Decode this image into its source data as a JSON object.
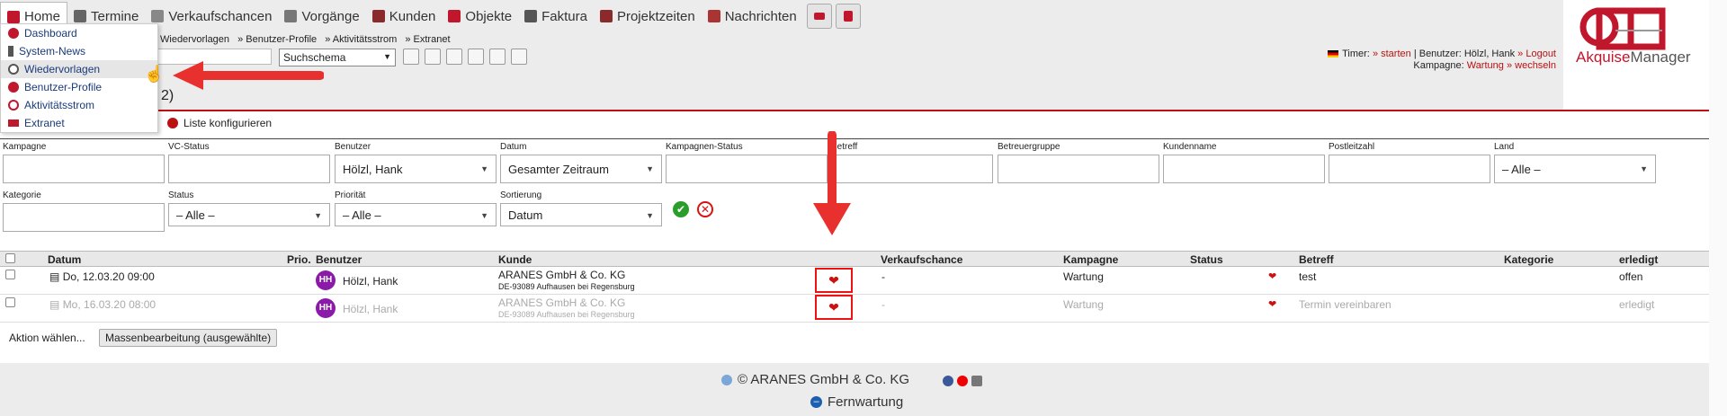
{
  "nav": {
    "items": [
      {
        "label": "Home",
        "icon": "home-icon"
      },
      {
        "label": "Termine",
        "icon": "calendar-icon"
      },
      {
        "label": "Verkaufschancen",
        "icon": "chart-icon"
      },
      {
        "label": "Vorgänge",
        "icon": "clipboard-icon"
      },
      {
        "label": "Kunden",
        "icon": "people-icon"
      },
      {
        "label": "Objekte",
        "icon": "phone-icon"
      },
      {
        "label": "Faktura",
        "icon": "invoice-icon"
      },
      {
        "label": "Projektzeiten",
        "icon": "gear-icon"
      },
      {
        "label": "Nachrichten",
        "icon": "mail-icon"
      }
    ]
  },
  "dropdown": {
    "items": [
      "Dashboard",
      "System-News",
      "Wiedervorlagen",
      "Benutzer-Profile",
      "Aktivitätsstrom",
      "Extranet"
    ]
  },
  "breadcrumb": {
    "items": [
      "Wiedervorlagen",
      "» Benutzer-Profile",
      "» Aktivitätsstrom",
      "» Extranet"
    ]
  },
  "search": {
    "schema": "Suchschema"
  },
  "userinfo": {
    "timer_label": "Timer:",
    "timer_link": "» starten",
    "user_label": "| Benutzer: Hölzl, Hank",
    "logout": "» Logout",
    "campaign_label": "Kampagne:",
    "campaign_value": "Wartung",
    "switch": "» wechseln"
  },
  "logo": {
    "text_a": "Akquise",
    "text_b": "Manager"
  },
  "page": {
    "count": "2)",
    "config_link": "Liste konfigurieren"
  },
  "filters": {
    "kampagne": {
      "label": "Kampagne",
      "value": ""
    },
    "vcstatus": {
      "label": "VC-Status",
      "value": ""
    },
    "benutzer": {
      "label": "Benutzer",
      "value": "Hölzl, Hank"
    },
    "datum": {
      "label": "Datum",
      "value": "Gesamter Zeitraum"
    },
    "kampstatus": {
      "label": "Kampagnen-Status",
      "value": ""
    },
    "betreff": {
      "label": "Betreff",
      "value": ""
    },
    "betreuergruppe": {
      "label": "Betreuergruppe",
      "value": ""
    },
    "kundenname": {
      "label": "Kundenname",
      "value": ""
    },
    "plz": {
      "label": "Postleitzahl",
      "value": ""
    },
    "land": {
      "label": "Land",
      "value": "– Alle –"
    },
    "kategorie": {
      "label": "Kategorie",
      "value": ""
    },
    "status": {
      "label": "Status",
      "value": "– Alle –"
    },
    "prioritaet": {
      "label": "Priorität",
      "value": "– Alle –"
    },
    "sortierung": {
      "label": "Sortierung",
      "value": "Datum"
    }
  },
  "table": {
    "headers": {
      "datum": "Datum",
      "prio": "Prio.",
      "benutzer": "Benutzer",
      "kunde": "Kunde",
      "verkaufschance": "Verkaufschance",
      "kampagne": "Kampagne",
      "status": "Status",
      "betreff": "Betreff",
      "kategorie": "Kategorie",
      "erledigt": "erledigt"
    },
    "rows": [
      {
        "datum": "Do, 12.03.20 09:00",
        "initials": "HH",
        "benutzer": "Hölzl, Hank",
        "kunde": "ARANES GmbH & Co. KG",
        "kunde_addr": "DE-93089 Aufhausen bei Regensburg",
        "verkaufschance": "-",
        "kampagne": "Wartung",
        "betreff": "test",
        "erledigt": "offen"
      },
      {
        "datum": "Mo, 16.03.20 08:00",
        "initials": "HH",
        "benutzer": "Hölzl, Hank",
        "kunde": "ARANES GmbH & Co. KG",
        "kunde_addr": "DE-93089 Aufhausen bei Regensburg",
        "verkaufschance": "-",
        "kampagne": "Wartung",
        "betreff": "Termin vereinbaren",
        "erledigt": "erledigt"
      }
    ]
  },
  "actions": {
    "label": "Aktion wählen...",
    "mass_edit": "Massenbearbeitung (ausgewählte)"
  },
  "footer": {
    "copyright": "© ARANES GmbH & Co. KG",
    "remote": "Fernwartung"
  },
  "colors": {
    "accent": "#c0172d",
    "arrow": "#e8312f",
    "avatar": "#8b1aa8"
  }
}
